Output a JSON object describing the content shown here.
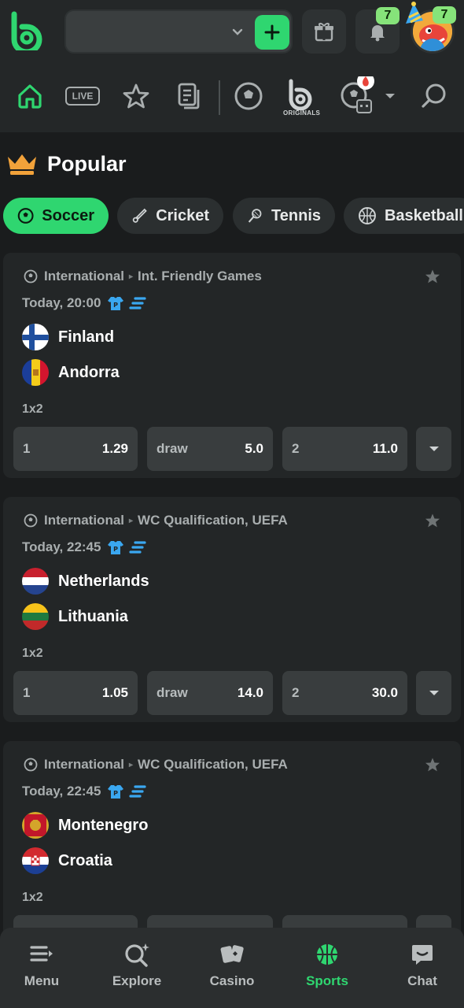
{
  "header": {
    "notifications_count": "7",
    "avatar_badge_count": "7"
  },
  "sports_nav": {
    "live_label": "LIVE",
    "originals_label": "ORIGINALS"
  },
  "popular": {
    "title": "Popular",
    "chips": [
      {
        "label": "Soccer",
        "icon": "soccer-icon",
        "active": true
      },
      {
        "label": "Cricket",
        "icon": "cricket-icon",
        "active": false
      },
      {
        "label": "Tennis",
        "icon": "tennis-icon",
        "active": false
      },
      {
        "label": "Basketball",
        "icon": "basketball-icon",
        "active": false
      }
    ]
  },
  "matches": [
    {
      "category": "International",
      "league": "Int. Friendly Games",
      "time": "Today, 20:00",
      "home": "Finland",
      "away": "Andorra",
      "market": "1x2",
      "odds": [
        {
          "label": "1",
          "value": "1.29"
        },
        {
          "label": "draw",
          "value": "5.0"
        },
        {
          "label": "2",
          "value": "11.0"
        }
      ]
    },
    {
      "category": "International",
      "league": "WC Qualification, UEFA",
      "time": "Today, 22:45",
      "home": "Netherlands",
      "away": "Lithuania",
      "market": "1x2",
      "odds": [
        {
          "label": "1",
          "value": "1.05"
        },
        {
          "label": "draw",
          "value": "14.0"
        },
        {
          "label": "2",
          "value": "30.0"
        }
      ]
    },
    {
      "category": "International",
      "league": "WC Qualification, UEFA",
      "time": "Today, 22:45",
      "home": "Montenegro",
      "away": "Croatia",
      "market": "1x2"
    }
  ],
  "bottom_nav": [
    {
      "label": "Menu",
      "icon": "menu-icon"
    },
    {
      "label": "Explore",
      "icon": "explore-icon"
    },
    {
      "label": "Casino",
      "icon": "casino-icon"
    },
    {
      "label": "Sports",
      "icon": "sports-icon",
      "active": true
    },
    {
      "label": "Chat",
      "icon": "chat-icon"
    }
  ],
  "colors": {
    "accent": "#2fd670",
    "badge": "#86e37a",
    "background": "#1a1c1d",
    "card": "#232627"
  }
}
